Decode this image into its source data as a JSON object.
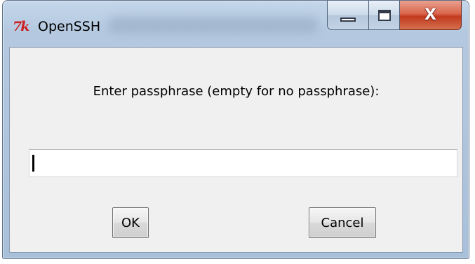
{
  "window": {
    "title": "OpenSSH",
    "app_icon_text": "7k",
    "app_icon_name": "tk-feather-icon",
    "caption": {
      "minimize_icon": "minimize-icon",
      "maximize_icon": "maximize-icon",
      "close_label": "X"
    }
  },
  "dialog": {
    "prompt": "Enter passphrase (empty for no passphrase):",
    "passphrase_value": "",
    "ok_label": "OK",
    "cancel_label": "Cancel"
  },
  "colors": {
    "close_button": "#c23a1e",
    "client_background": "#f0f0f0",
    "app_icon": "#cc1f1f"
  }
}
